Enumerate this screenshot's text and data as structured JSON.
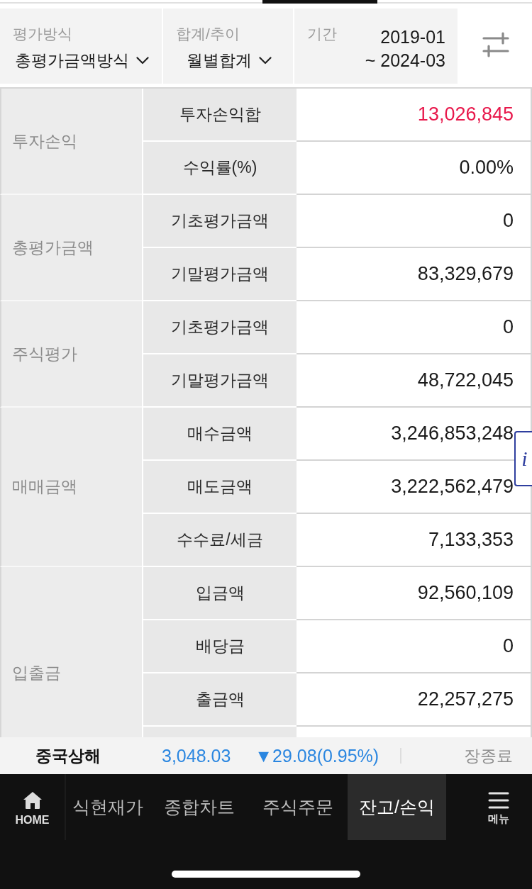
{
  "top_filters": [
    {
      "kind": "dropdown",
      "label": "평가방식",
      "value": "총평가금액방식"
    },
    {
      "kind": "dropdown",
      "label": "합계/추이",
      "value": "월별합계"
    },
    {
      "kind": "range",
      "label": "기간",
      "start": "2019-01",
      "end": "~ 2024-03"
    }
  ],
  "table": {
    "cut_off": true,
    "groups": [
      {
        "category": "투자손익",
        "rows": [
          {
            "label": "투자손익합",
            "value": "13,026,845",
            "color": "#e8194c"
          },
          {
            "label": "수익률(%)",
            "value": "0.00%",
            "color": "#1a1a1a"
          }
        ]
      },
      {
        "category": "총평가금액",
        "rows": [
          {
            "label": "기초평가금액",
            "value": "0",
            "color": "#1a1a1a"
          },
          {
            "label": "기말평가금액",
            "value": "83,329,679",
            "color": "#1a1a1a"
          }
        ]
      },
      {
        "category": "주식평가",
        "rows": [
          {
            "label": "기초평가금액",
            "value": "0",
            "color": "#1a1a1a"
          },
          {
            "label": "기말평가금액",
            "value": "48,722,045",
            "color": "#1a1a1a"
          }
        ]
      },
      {
        "category": "매매금액",
        "rows": [
          {
            "label": "매수금액",
            "value": "3,246,853,248",
            "color": "#1a1a1a"
          },
          {
            "label": "매도금액",
            "value": "3,222,562,479",
            "color": "#1a1a1a"
          },
          {
            "label": "수수료/세금",
            "value": "7,133,353",
            "color": "#1a1a1a"
          }
        ]
      },
      {
        "category": "입출금",
        "rows": [
          {
            "label": "입금액",
            "value": "92,560,109",
            "color": "#1a1a1a"
          },
          {
            "label": "배당금",
            "value": "0",
            "color": "#1a1a1a"
          },
          {
            "label": "출금액",
            "value": "22,257,275",
            "color": "#1a1a1a"
          }
        ]
      }
    ]
  },
  "info_button": {
    "label": "i"
  },
  "ticker": {
    "name": "중국상해",
    "price": "3,048.03",
    "change": "▼29.08(0.95%)",
    "falling": true,
    "status": "장종료"
  },
  "bottom_nav": {
    "home": {
      "label": "HOME"
    },
    "tabs": [
      {
        "label": "식현재가",
        "selected": false
      },
      {
        "label": "종합차트",
        "selected": false
      },
      {
        "label": "주식주문",
        "selected": false
      },
      {
        "label": "잔고/손익",
        "selected": true
      }
    ],
    "menu": {
      "label": "메뉴"
    }
  }
}
